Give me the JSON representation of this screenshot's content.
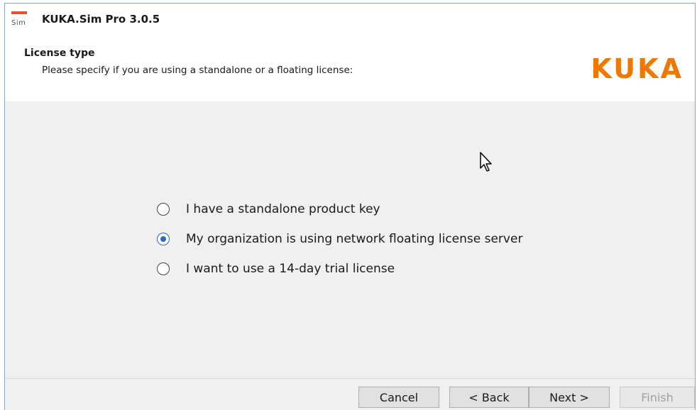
{
  "window": {
    "title": "KUKA.Sim Pro 3.0.5",
    "icon": "kuka-sim-app-icon",
    "icon_label": "Sim"
  },
  "header": {
    "title": "License type",
    "description": "Please specify if you are using a standalone or a floating license:",
    "logo_text": "KUKA"
  },
  "license_options": [
    {
      "label": "I have a standalone product key",
      "selected": false
    },
    {
      "label": "My organization is using network floating license server",
      "selected": true
    },
    {
      "label": "I want to use a 14-day trial license",
      "selected": false
    }
  ],
  "buttons": {
    "cancel": "Cancel",
    "back": "< Back",
    "next": "Next >",
    "finish": "Finish"
  },
  "colors": {
    "brand": "#f07800",
    "accent": "#2b6ac8",
    "app_icon_bar": "#e8502a"
  }
}
